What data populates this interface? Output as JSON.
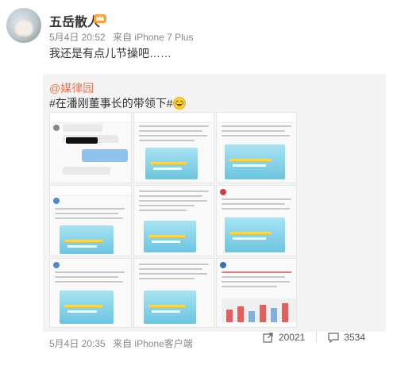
{
  "post": {
    "author": "五岳散人",
    "badge_icon": "vip-crown-icon",
    "time": "5月4日 20:52",
    "source": "来自 iPhone 7 Plus",
    "text": "我还是有点儿节操吧……"
  },
  "quoted": {
    "author": "@媒律园",
    "text": "#在潘刚董事长的带领下#",
    "emoji_icon": "laugh-cry-icon",
    "time": "5月4日 20:35",
    "source": "来自 iPhone客户端",
    "repost_count": "20021",
    "comment_count": "3534"
  }
}
